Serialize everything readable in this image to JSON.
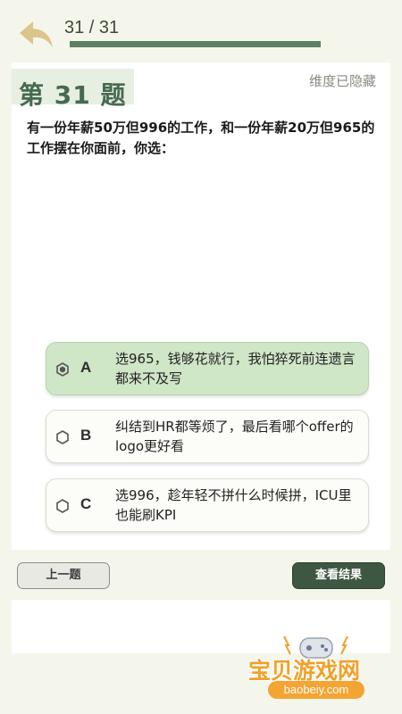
{
  "header": {
    "counter": "31 / 31",
    "progress": 1.0
  },
  "question": {
    "title": "第 31 题",
    "dimension_status": "维度已隐藏",
    "text": "有一份年薪50万但996的工作，和一份年薪20万但965的工作摆在你面前，你选："
  },
  "options": [
    {
      "letter": "A",
      "text": "选965，钱够花就行，我怕猝死前连遗言都来不及写",
      "selected": true
    },
    {
      "letter": "B",
      "text": "纠结到HR都等烦了，最后看哪个offer的logo更好看",
      "selected": false
    },
    {
      "letter": "C",
      "text": "选996，趁年轻不拼什么时候拼，ICU里也能刷KPI",
      "selected": false
    }
  ],
  "footer": {
    "prev_label": "上一题",
    "result_label": "查看结果"
  },
  "watermark": {
    "name": "宝贝游戏网",
    "url": "baobeiy.com"
  },
  "colors": {
    "accent": "#466a4f",
    "selected_option": "#cfe6c7",
    "result_button": "#3e5742",
    "watermark": "#f0a12a"
  }
}
